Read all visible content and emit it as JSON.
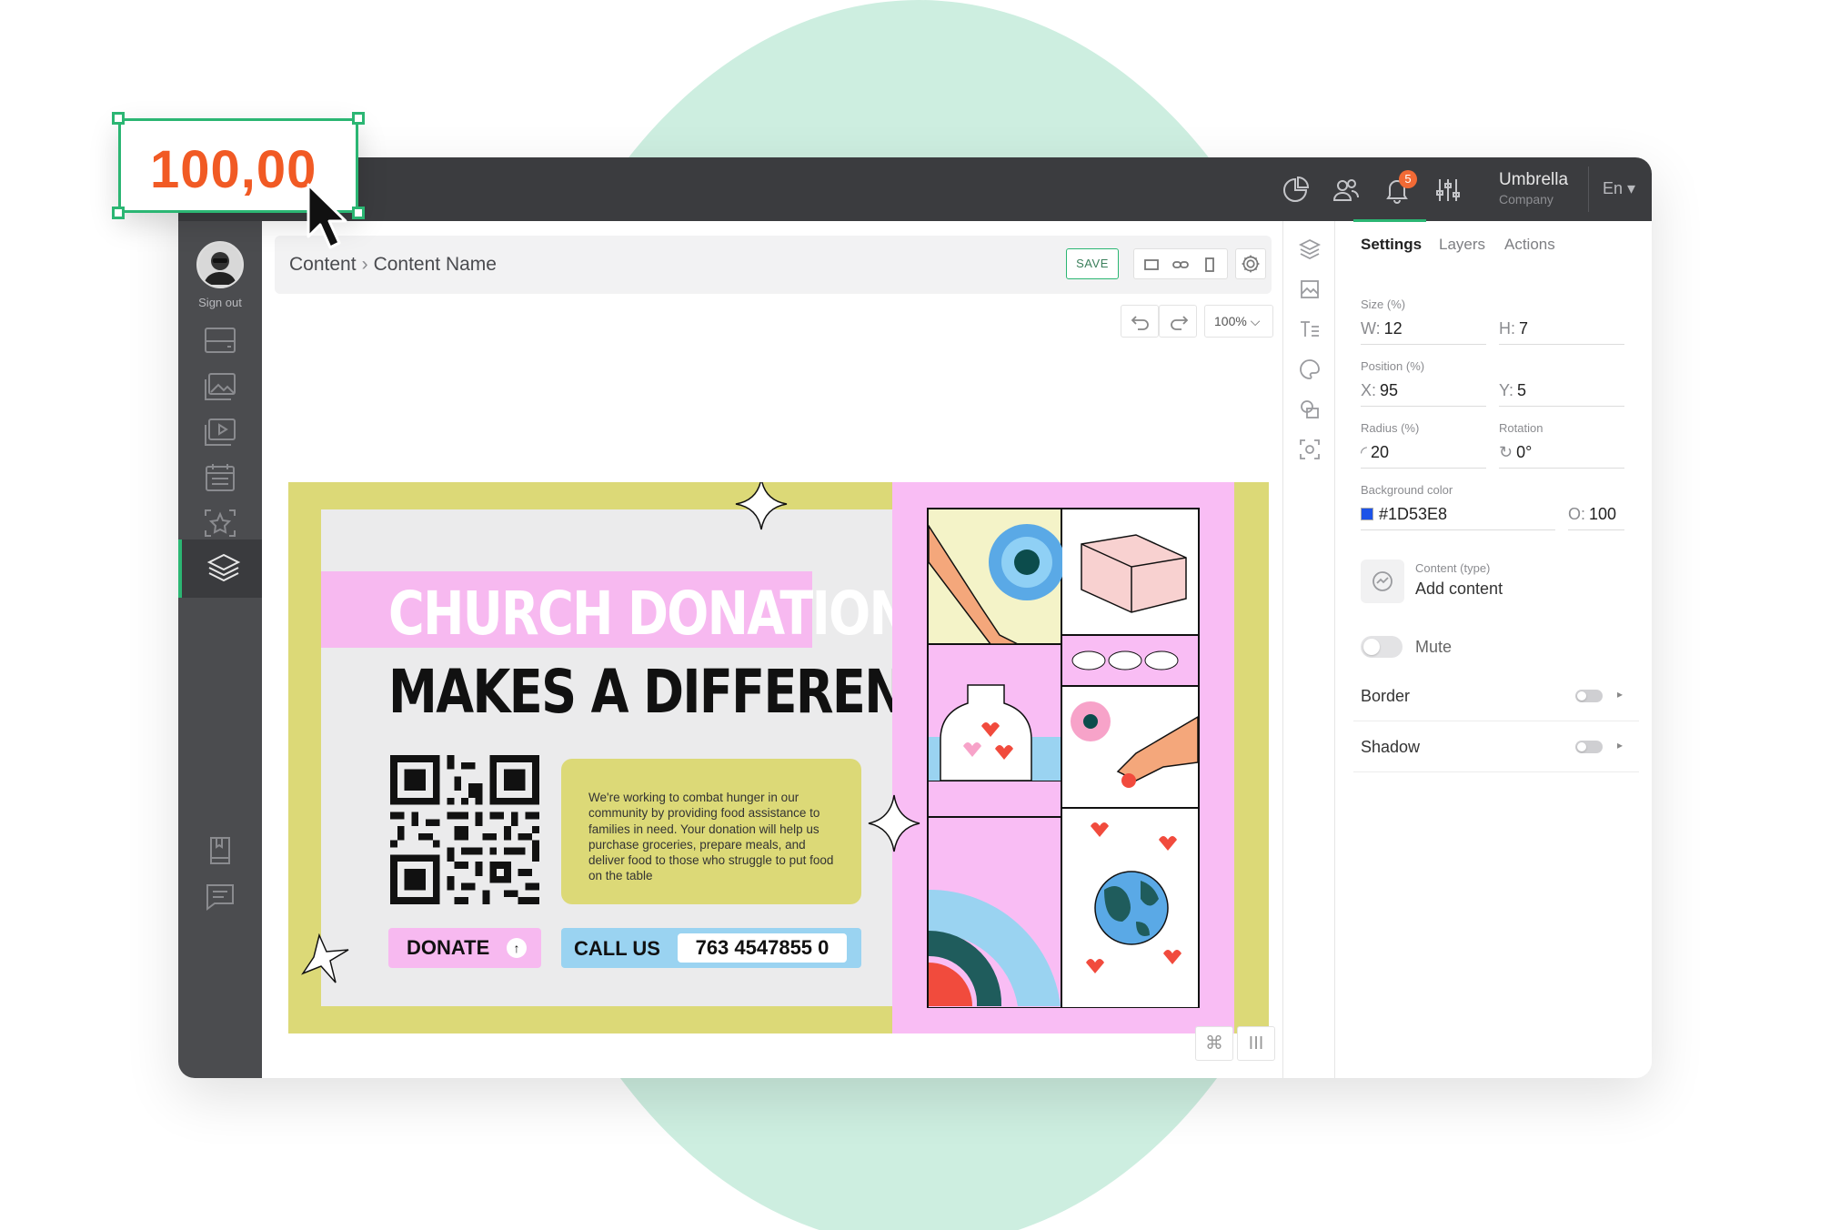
{
  "topbar": {
    "icons": [
      "analytics-icon",
      "users-icon",
      "notifications-icon",
      "settings-sliders-icon"
    ],
    "notification_count": "5",
    "company_name": "Umbrella",
    "company_sub": "Company",
    "language": "En ▾"
  },
  "sidebar": {
    "sign_out": "Sign out",
    "items": [
      "displays-icon",
      "images-icon",
      "videos-icon",
      "schedule-icon",
      "favorites-icon",
      "content-layers-icon"
    ],
    "bottom": [
      "book-icon",
      "chat-icon"
    ]
  },
  "breadcrumb": {
    "root": "Content",
    "separator": "›",
    "current": "Content Name"
  },
  "toolbar": {
    "save_label": "SAVE",
    "zoom": "100% ⌵"
  },
  "poster": {
    "headline1": "CHURCH DONATION",
    "headline2": "MAKES A DIFFERENCE",
    "info_text": "We're working to combat hunger in our community by providing food assistance to families in need. Your donation will help us purchase groceries, prepare meals, and deliver food to those who struggle to put food on the table",
    "donate_label": "DONATE",
    "call_label": "CALL US",
    "phone": "763 4547855 0",
    "colors": {
      "lime": "#dcd977",
      "pink": "#f7b9f0",
      "blue": "#9ad3f1"
    }
  },
  "panel": {
    "tabs": [
      "Settings",
      "Layers",
      "Actions"
    ],
    "active_tab": "Settings",
    "size_label": "Size (%)",
    "w_prefix": "W:",
    "w_value": "12",
    "h_prefix": "H:",
    "h_value": "7",
    "position_label": "Position (%)",
    "x_prefix": "X:",
    "x_value": "95",
    "y_prefix": "Y:",
    "y_value": "5",
    "radius_label": "Radius (%)",
    "radius_value": "20",
    "rotation_label": "Rotation",
    "rotation_value": "0°",
    "bg_label": "Background color",
    "bg_value": "#1D53E8",
    "opacity_prefix": "O:",
    "opacity_value": "100",
    "content_type_label": "Content (type)",
    "content_type_value": "Add content",
    "mute_label": "Mute",
    "border_label": "Border",
    "shadow_label": "Shadow"
  },
  "bottom_buttons": [
    "⌘",
    "III"
  ],
  "callout": {
    "value": "100,00"
  },
  "colors": {
    "accent": "#2bb673",
    "topbar": "#3b3c3f",
    "sidebar": "#4b4c4f",
    "callout_text": "#f15a24",
    "background_circle": "#cdeee0"
  }
}
